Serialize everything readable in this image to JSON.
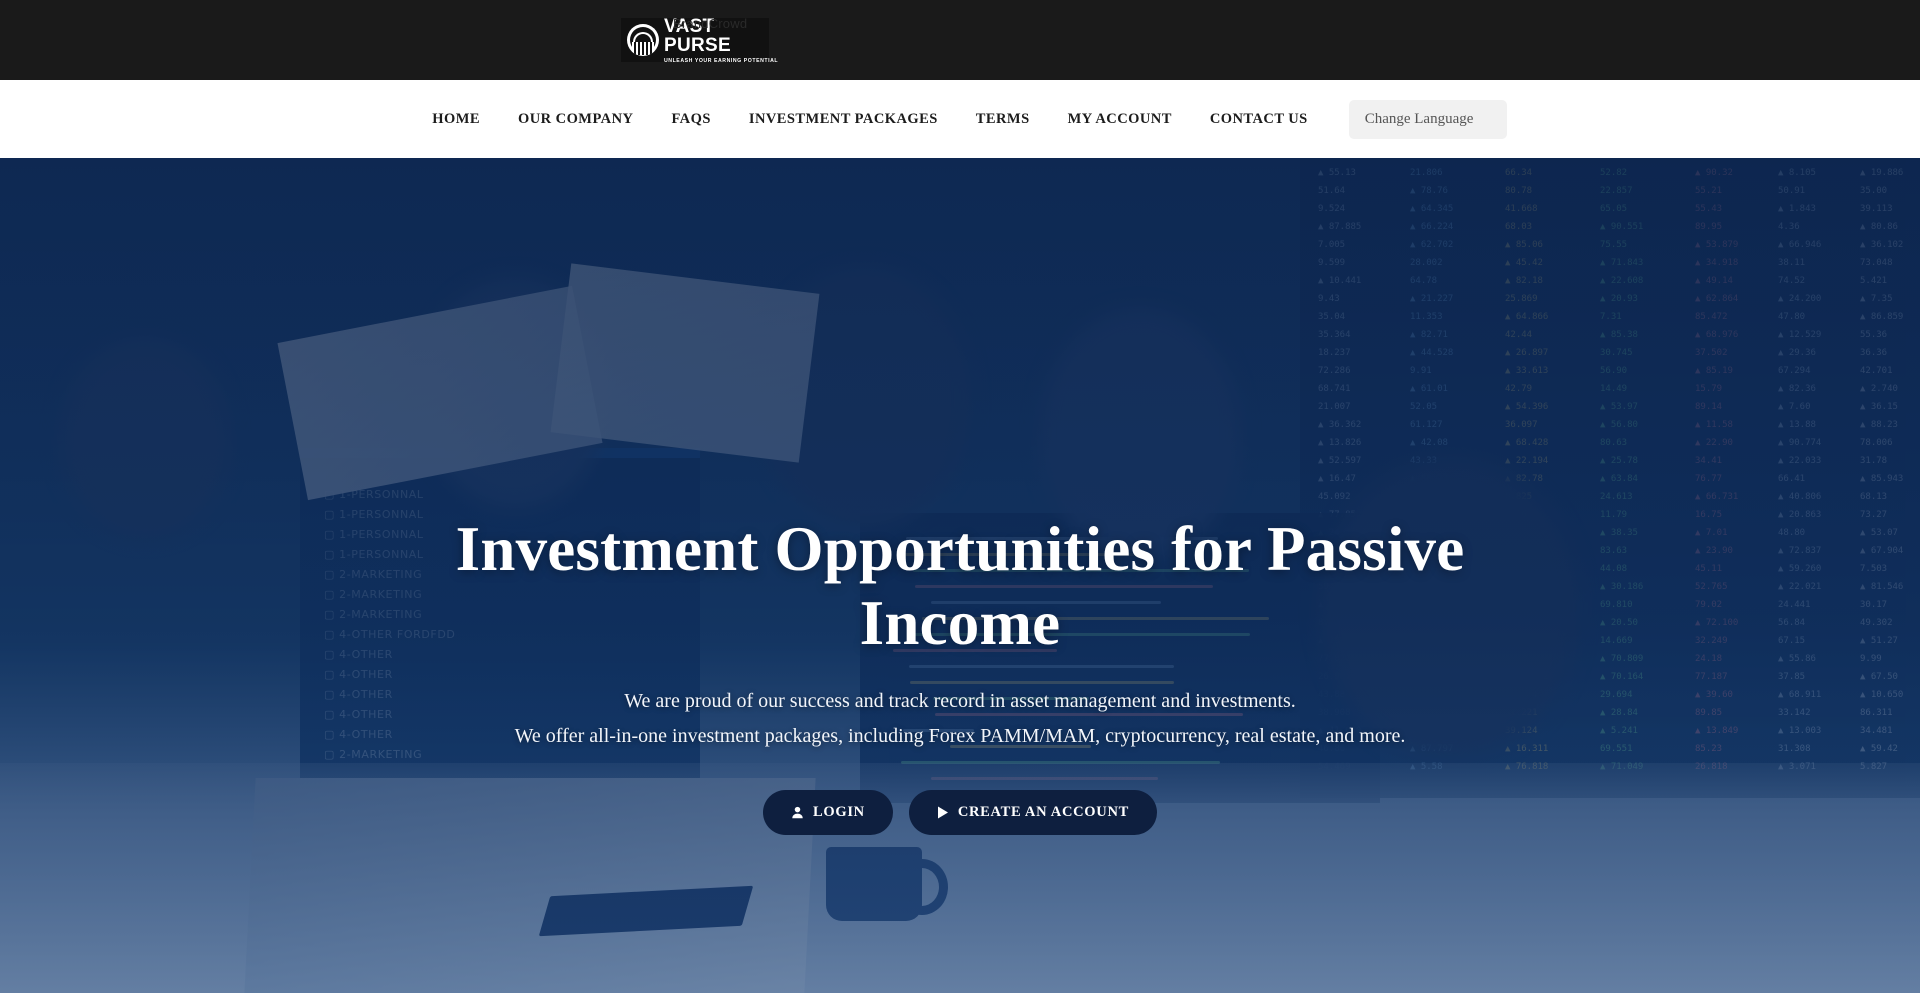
{
  "brand": {
    "name": "VAST PURSE",
    "tagline": "UNLEASH YOUR EARNING POTENTIAL",
    "watermark": "BrandCrowd",
    "logo_icon": "purse-emblem-icon"
  },
  "nav": {
    "items": [
      {
        "label": "HOME"
      },
      {
        "label": "OUR COMPANY"
      },
      {
        "label": "FAQS"
      },
      {
        "label": "INVESTMENT PACKAGES"
      },
      {
        "label": "TERMS"
      },
      {
        "label": "MY ACCOUNT"
      },
      {
        "label": "CONTACT US"
      }
    ],
    "language_selector": {
      "label": "Change Language",
      "options": [
        "Change Language"
      ]
    }
  },
  "hero": {
    "title": "Investment Opportunities for Passive Income",
    "subtitle_line1": "We are proud of our success and track record in asset management and investments.",
    "subtitle_line2": "We offer all-in-one investment packages, including Forex PAMM/MAM, cryptocurrency, real estate, and more.",
    "buttons": {
      "login": {
        "label": "LOGIN",
        "icon": "user-icon"
      },
      "create_account": {
        "label": "CREATE AN ACCOUNT",
        "icon": "play-icon"
      }
    }
  },
  "colors": {
    "topbar_background": "#1a1a1a",
    "navbar_background": "#ffffff",
    "nav_text": "#1c1c1c",
    "hero_overlay": "#0d264f",
    "button_background": "#0e1f3f",
    "button_text": "#ffffff",
    "language_field_background": "#f1f1f1"
  }
}
